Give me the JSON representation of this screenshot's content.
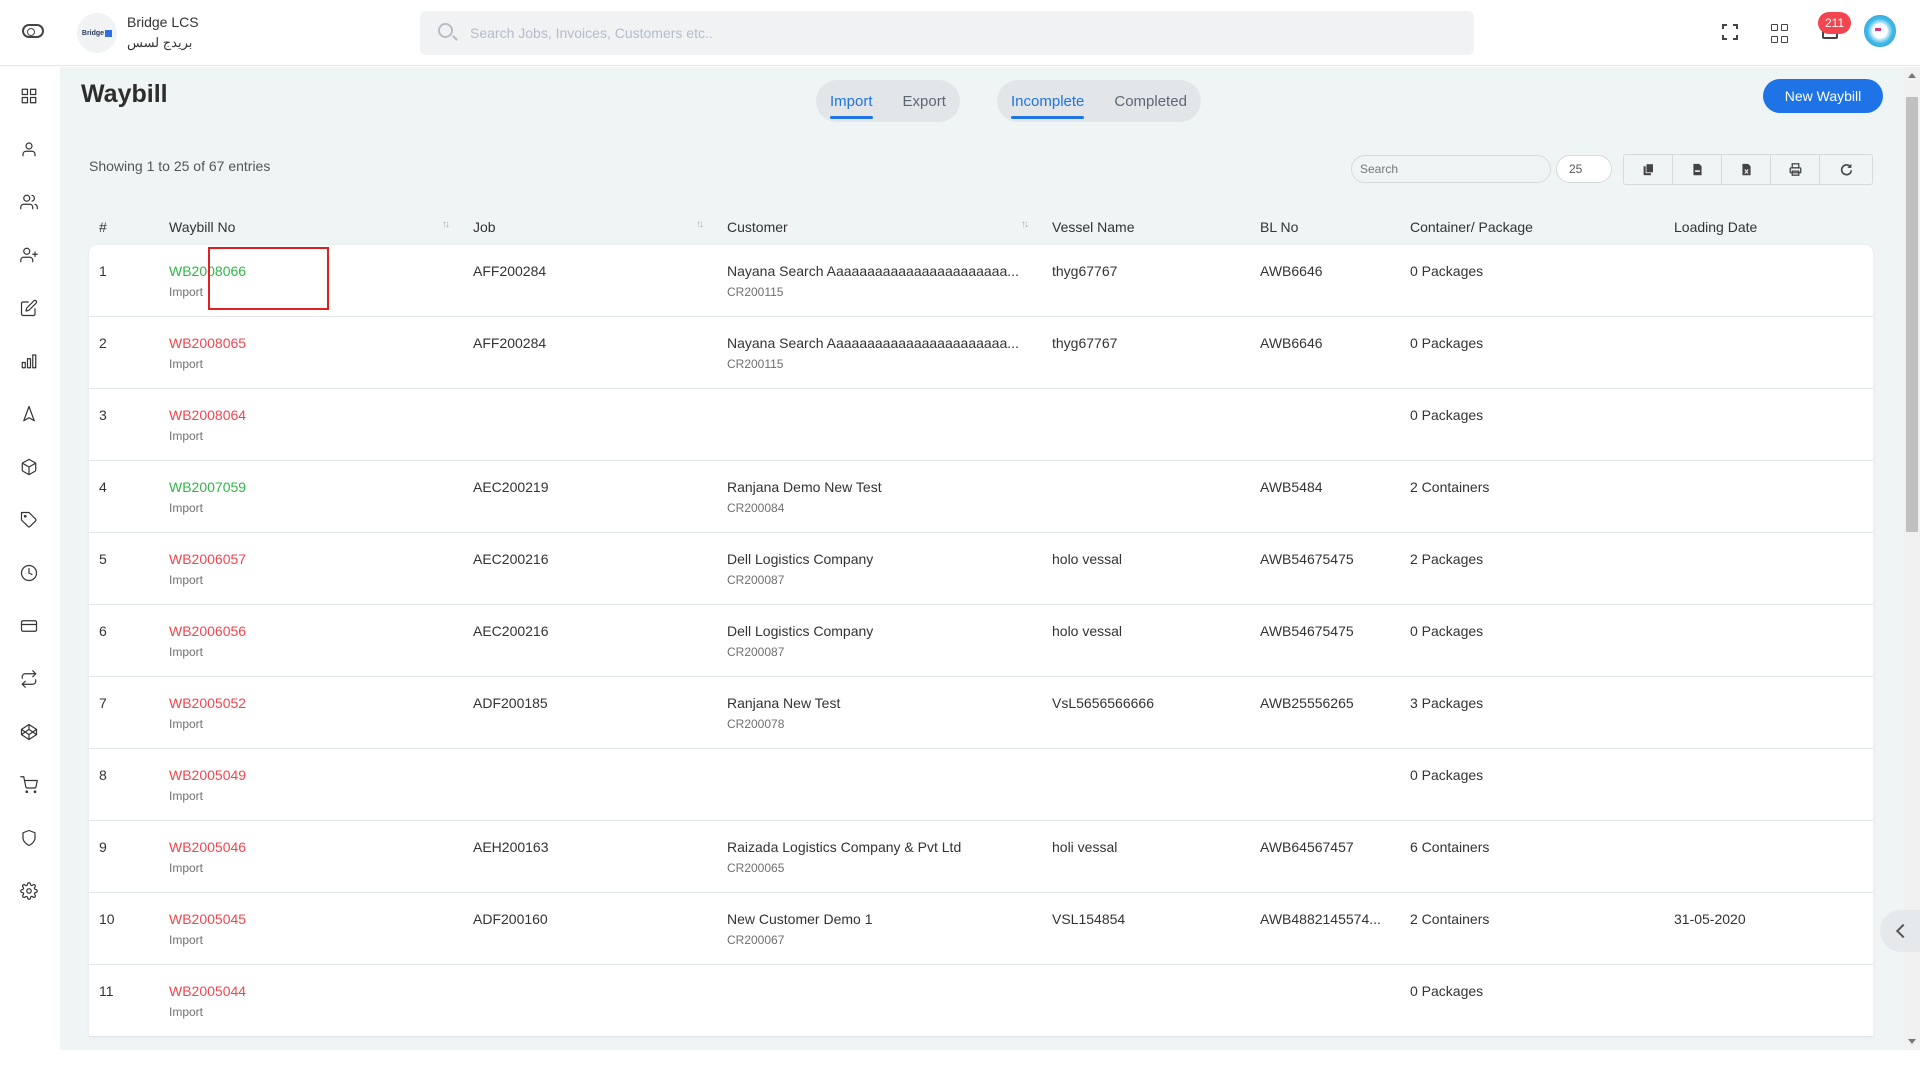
{
  "header": {
    "brand_name": "Bridge LCS",
    "brand_name_ar": "بريدج لسس",
    "logo_text": "Bridge",
    "search_placeholder": "Search Jobs, Invoices, Customers etc..",
    "notification_count": "211"
  },
  "sidebar": {
    "items": [
      {
        "icon": "dashboard-icon"
      },
      {
        "icon": "user-icon"
      },
      {
        "icon": "users-icon"
      },
      {
        "icon": "user-plus-icon"
      },
      {
        "icon": "edit-icon"
      },
      {
        "icon": "bar-chart-icon"
      },
      {
        "icon": "navigation-icon"
      },
      {
        "icon": "package-icon"
      },
      {
        "icon": "tag-icon"
      },
      {
        "icon": "clock-icon"
      },
      {
        "icon": "credit-card-icon"
      },
      {
        "icon": "repeat-icon"
      },
      {
        "icon": "codepen-icon"
      },
      {
        "icon": "cart-icon"
      },
      {
        "icon": "shield-icon"
      },
      {
        "icon": "settings-icon"
      }
    ]
  },
  "page": {
    "title": "Waybill",
    "direction_tabs": [
      {
        "label": "Import",
        "active": true
      },
      {
        "label": "Export",
        "active": false
      }
    ],
    "status_tabs": [
      {
        "label": "Incomplete",
        "active": true
      },
      {
        "label": "Completed",
        "active": false
      }
    ],
    "new_button": "New Waybill",
    "entries_info": "Showing 1 to 25 of 67 entries",
    "table_search_placeholder": "Search",
    "page_length": "25",
    "toolbar_buttons": [
      "copy-icon",
      "csv-icon",
      "excel-icon",
      "print-icon",
      "refresh-icon"
    ]
  },
  "colors": {
    "accent": "#1e73e6",
    "completed_green": "#34b44a",
    "incomplete_red": "#f1454f",
    "badge_red": "#f1454f"
  },
  "table": {
    "columns": [
      "#",
      "Waybill No",
      "Job",
      "Customer",
      "Vessel Name",
      "BL No",
      "Container/ Package",
      "Loading Date"
    ],
    "rows": [
      {
        "num": "1",
        "waybill": "WB2008066",
        "status": "green",
        "type": "Import",
        "job": "AFF200284",
        "customer": "Nayana Search Aaaaaaaaaaaaaaaaaaaaaaa...",
        "customer_code": "CR200115",
        "vessel": "thyg67767",
        "bl": "AWB6646",
        "container": "0 Packages",
        "loading_date": ""
      },
      {
        "num": "2",
        "waybill": "WB2008065",
        "status": "red",
        "type": "Import",
        "job": "AFF200284",
        "customer": "Nayana Search Aaaaaaaaaaaaaaaaaaaaaaa...",
        "customer_code": "CR200115",
        "vessel": "thyg67767",
        "bl": "AWB6646",
        "container": "0 Packages",
        "loading_date": ""
      },
      {
        "num": "3",
        "waybill": "WB2008064",
        "status": "red",
        "type": "Import",
        "job": "",
        "customer": "",
        "customer_code": "",
        "vessel": "",
        "bl": "",
        "container": "0 Packages",
        "loading_date": ""
      },
      {
        "num": "4",
        "waybill": "WB2007059",
        "status": "green",
        "type": "Import",
        "job": "AEC200219",
        "customer": "Ranjana Demo New Test",
        "customer_code": "CR200084",
        "vessel": "",
        "bl": "AWB5484",
        "container": "2 Containers",
        "loading_date": ""
      },
      {
        "num": "5",
        "waybill": "WB2006057",
        "status": "red",
        "type": "Import",
        "job": "AEC200216",
        "customer": "Dell Logistics Company",
        "customer_code": "CR200087",
        "vessel": "holo vessal",
        "bl": "AWB54675475",
        "container": "2 Packages",
        "loading_date": ""
      },
      {
        "num": "6",
        "waybill": "WB2006056",
        "status": "red",
        "type": "Import",
        "job": "AEC200216",
        "customer": "Dell Logistics Company",
        "customer_code": "CR200087",
        "vessel": "holo vessal",
        "bl": "AWB54675475",
        "container": "0 Packages",
        "loading_date": ""
      },
      {
        "num": "7",
        "waybill": "WB2005052",
        "status": "red",
        "type": "Import",
        "job": "ADF200185",
        "customer": "Ranjana New Test",
        "customer_code": "CR200078",
        "vessel": "VsL5656566666",
        "bl": "AWB25556265",
        "container": "3 Packages",
        "loading_date": ""
      },
      {
        "num": "8",
        "waybill": "WB2005049",
        "status": "red",
        "type": "Import",
        "job": "",
        "customer": "",
        "customer_code": "",
        "vessel": "",
        "bl": "",
        "container": "0 Packages",
        "loading_date": ""
      },
      {
        "num": "9",
        "waybill": "WB2005046",
        "status": "red",
        "type": "Import",
        "job": "AEH200163",
        "customer": "Raizada Logistics Company & Pvt Ltd",
        "customer_code": "CR200065",
        "vessel": "holi vessal",
        "bl": "AWB64567457",
        "container": "6 Containers",
        "loading_date": ""
      },
      {
        "num": "10",
        "waybill": "WB2005045",
        "status": "red",
        "type": "Import",
        "job": "ADF200160",
        "customer": "New Customer Demo 1",
        "customer_code": "CR200067",
        "vessel": "VSL154854",
        "bl": "AWB4882145574...",
        "container": "2 Containers",
        "loading_date": "31-05-2020"
      },
      {
        "num": "11",
        "waybill": "WB2005044",
        "status": "red",
        "type": "Import",
        "job": "",
        "customer": "",
        "customer_code": "",
        "vessel": "",
        "bl": "",
        "container": "0 Packages",
        "loading_date": ""
      }
    ]
  }
}
